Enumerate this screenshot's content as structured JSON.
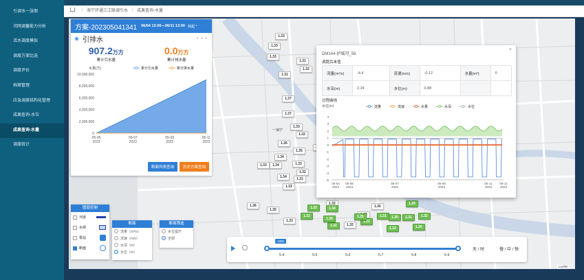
{
  "sidebar": {
    "items": [
      {
        "label": "引调水一张图"
      },
      {
        "label": "河网调蓄能力分析"
      },
      {
        "label": "活水调度模拟"
      },
      {
        "label": "调度方案比选"
      },
      {
        "label": "调度评价"
      },
      {
        "label": "档案管理"
      },
      {
        "label": "应急调度结构化管理"
      },
      {
        "label": "成果查询-水位"
      },
      {
        "label": "成果查询-水量"
      },
      {
        "label": "调度统计"
      }
    ],
    "active_index": 8
  },
  "breadcrumb": {
    "items": [
      "海宁环通三江联调引水",
      "成果查询-水量"
    ]
  },
  "scheme_panel": {
    "scheme_id": "方案-202305041341",
    "time_range": "06/04 13:00—06/11 13:00",
    "state": "收起 ^",
    "title": "引排水",
    "stat_in_value": "907.2",
    "stat_in_unit": "万方",
    "stat_in_label": "累计引水量",
    "stat_out_value": "0.0",
    "stat_out_unit": "万方",
    "stat_out_label": "累计排水量",
    "btn_query": "断面列表查询",
    "btn_history": "历史方案查询"
  },
  "chart_data": [
    {
      "type": "area",
      "ylabel": "水量(方)",
      "legend": [
        "累计引水量",
        "累计排水量"
      ],
      "legend_placement": "top-right",
      "x": [
        "05-05 2023",
        "05-07 2023",
        "05-09 2023",
        "05-11 2023"
      ],
      "yticks": [
        "0",
        "2,000,000",
        "4,000,000",
        "6,000,000",
        "8,000,000",
        "10,000,000"
      ],
      "ylim": [
        0,
        10000000
      ],
      "series": [
        {
          "name": "累计引水量",
          "color": "#5b9be3",
          "values": [
            0,
            3000000,
            6000000,
            9072000
          ]
        },
        {
          "name": "累计排水量",
          "color": "#f0a030",
          "values": [
            0,
            0,
            0,
            0
          ]
        }
      ]
    },
    {
      "type": "line",
      "ylabel": "水位(m)",
      "legend": [
        "流量",
        "流速",
        "水量",
        "水深",
        "水位"
      ],
      "x": [
        "05-04 2023",
        "05-05 2023",
        "05-07 2023",
        "05-09 2023",
        "05-11 2023",
        "05-11 2023"
      ],
      "yticks": [
        "-5",
        "-4",
        "-3",
        "-2",
        "-1",
        "0",
        "1",
        "2",
        "3",
        "4"
      ],
      "ylim": [
        -5,
        4
      ],
      "series": [
        {
          "name": "流量",
          "color": "#4a7fd6"
        },
        {
          "name": "流速",
          "color": "#f0a030"
        },
        {
          "name": "水量",
          "color": "#e8553c"
        },
        {
          "name": "水深",
          "color": "#6fbf53"
        },
        {
          "name": "水位",
          "color": "#9aa7b5"
        }
      ]
    }
  ],
  "legend_panel": {
    "title": "图层控制",
    "rows": [
      {
        "label": "河道",
        "checked": false
      },
      {
        "label": "水闸",
        "checked": false
      },
      {
        "label": "泵站",
        "checked": false
      },
      {
        "label": "断面",
        "checked": true
      }
    ]
  },
  "section_panel": {
    "title": "断面",
    "rows": [
      {
        "label": "流量（m³/s）",
        "checked": false
      },
      {
        "label": "流速（m/s）",
        "checked": false
      },
      {
        "label": "水深（m）",
        "checked": false
      },
      {
        "label": "水位（m）",
        "checked": true
      }
    ]
  },
  "filter_panel": {
    "title": "断面筛选",
    "rows": [
      {
        "label": "水位提升",
        "checked": false
      },
      {
        "label": "全部",
        "checked": true
      }
    ]
  },
  "popup": {
    "title": "DM144-护城河_58",
    "subtitle": "调度后末值",
    "rows": [
      [
        {
          "k": "流量(m³/s)",
          "v": "-4.4"
        },
        {
          "k": "流速(m/s)",
          "v": "-0.12"
        },
        {
          "k": "水量(m³)",
          "v": "0"
        }
      ],
      [
        {
          "k": "水深(m)",
          "v": "2.24"
        },
        {
          "k": "水位(m)",
          "v": "0.88"
        }
      ]
    ],
    "curve_title": "过程曲线",
    "close": "×"
  },
  "map": {
    "place_label": "一海宁",
    "tags_white": [
      "1.33",
      "1.33",
      "1.33",
      "1.31",
      "1.32",
      "1.31",
      "1.37",
      "1.37",
      "1.36",
      "1.34",
      "1.35",
      "1.33",
      "1.32",
      "1.33",
      "1.34",
      "1.31",
      "1.34",
      "1.33",
      "1.36",
      "1.35",
      "1.33",
      "1.33",
      "1.32",
      "1.31",
      "1.32",
      "1.32",
      "1.30",
      "1.33"
    ],
    "tags_green": [
      "1.32",
      "1.32",
      "1.34",
      "1.32",
      "1.21",
      "1.31",
      "1.30",
      "1.31",
      "1.32",
      "1.35",
      "1.26",
      "1.32",
      "1.29",
      "1.31"
    ]
  },
  "timeline": {
    "tip": "1986",
    "ticks": [
      "5-4",
      "5-5",
      "5-6",
      "5-7",
      "5-8",
      "5-9"
    ],
    "speed_unit": "天 / 时",
    "speed": "慢 / 中 / 快"
  },
  "attribution": "Leaflet"
}
